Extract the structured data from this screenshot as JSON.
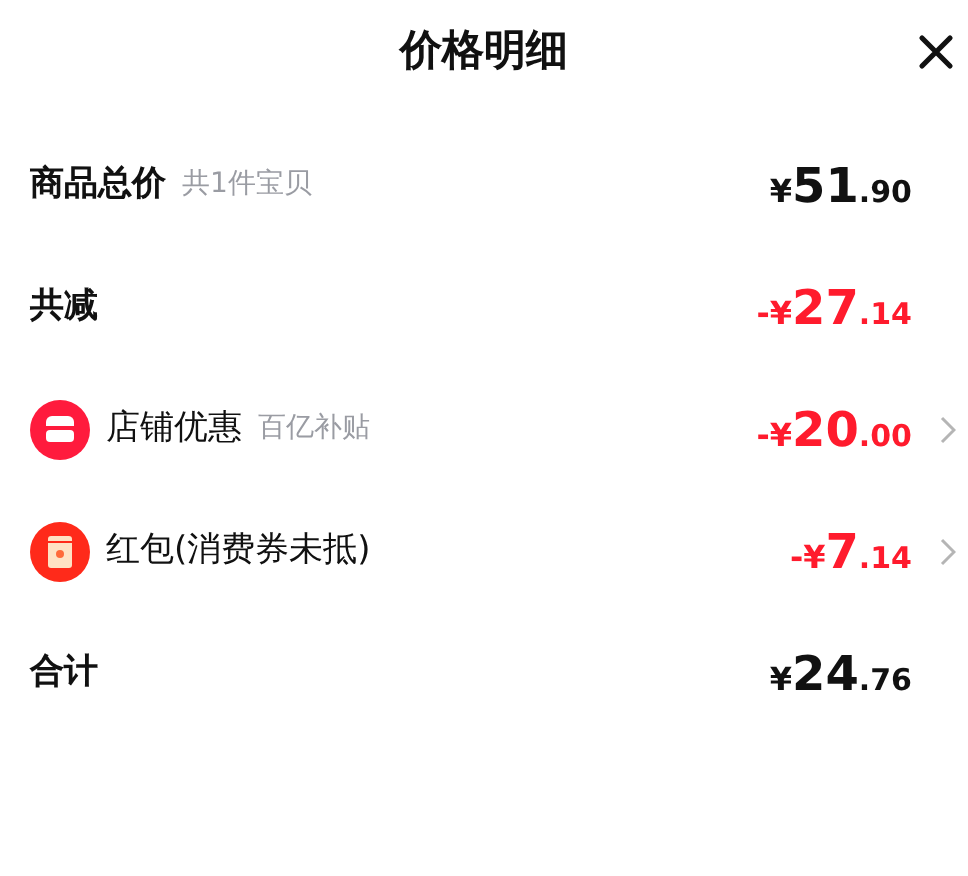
{
  "title": "价格明细",
  "rows": [
    {
      "kind": "plain",
      "label": "商品总价",
      "note": "共1件宝贝",
      "price": {
        "prefix": "¥",
        "int": "51",
        "dec": ".90"
      },
      "negative": false,
      "chevron": false
    },
    {
      "kind": "plain",
      "label": "共减",
      "price": {
        "prefix": "-¥",
        "int": "27",
        "dec": ".14"
      },
      "negative": true,
      "chevron": false
    },
    {
      "kind": "shop",
      "label": "店铺优惠",
      "note": "百亿补贴",
      "price": {
        "prefix": "-¥",
        "int": "20",
        "dec": ".00"
      },
      "negative": true,
      "chevron": true
    },
    {
      "kind": "envelope",
      "label": "红包(消费券未抵)",
      "price": {
        "prefix": "-¥",
        "int": "7",
        "dec": ".14"
      },
      "negative": true,
      "chevron": true
    },
    {
      "kind": "plain",
      "label": "合计",
      "price": {
        "prefix": "¥",
        "int": "24",
        "dec": ".76"
      },
      "negative": false,
      "chevron": false
    }
  ]
}
